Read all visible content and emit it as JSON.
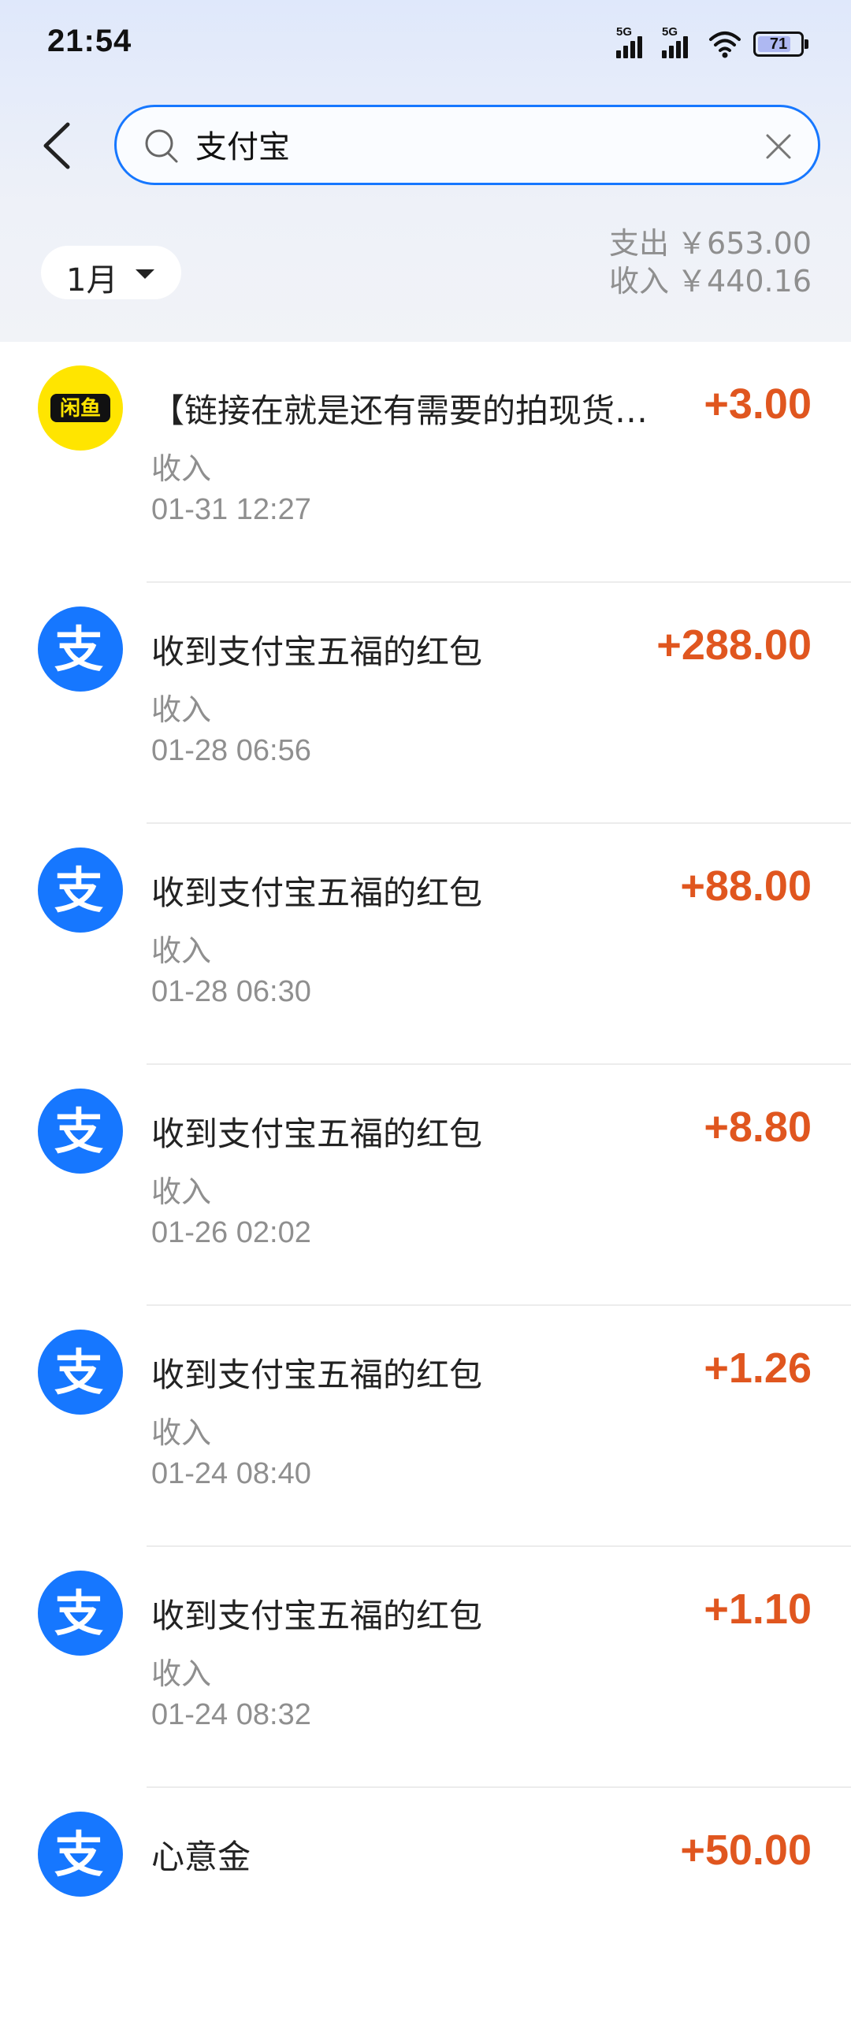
{
  "status_bar": {
    "time": "21:54",
    "signal1_label": "5G",
    "signal2_label": "5G",
    "battery": "71"
  },
  "search": {
    "value": "支付宝"
  },
  "filter": {
    "month": "1月"
  },
  "totals": {
    "expense_label": "支出",
    "expense_value": "￥653.00",
    "income_label": "收入",
    "income_value": "￥440.16"
  },
  "transactions": [
    {
      "icon": "xianyu-logo-icon",
      "title": "【链接在就是还有需要的拍现货…",
      "amount": "+3.00",
      "type": "收入",
      "time": "01-31 12:27"
    },
    {
      "icon": "alipay-logo-icon",
      "title": "收到支付宝五福的红包",
      "amount": "+288.00",
      "type": "收入",
      "time": "01-28 06:56"
    },
    {
      "icon": "alipay-logo-icon",
      "title": "收到支付宝五福的红包",
      "amount": "+88.00",
      "type": "收入",
      "time": "01-28 06:30"
    },
    {
      "icon": "alipay-logo-icon",
      "title": "收到支付宝五福的红包",
      "amount": "+8.80",
      "type": "收入",
      "time": "01-26 02:02"
    },
    {
      "icon": "alipay-logo-icon",
      "title": "收到支付宝五福的红包",
      "amount": "+1.26",
      "type": "收入",
      "time": "01-24 08:40"
    },
    {
      "icon": "alipay-logo-icon",
      "title": "收到支付宝五福的红包",
      "amount": "+1.10",
      "type": "收入",
      "time": "01-24 08:32"
    },
    {
      "icon": "alipay-logo-icon",
      "title": "心意金",
      "amount": "+50.00",
      "type": "",
      "time": ""
    }
  ],
  "colors": {
    "accent": "#1677ff",
    "income_amount": "#e0561f",
    "xianyu_yellow": "#ffe500"
  }
}
